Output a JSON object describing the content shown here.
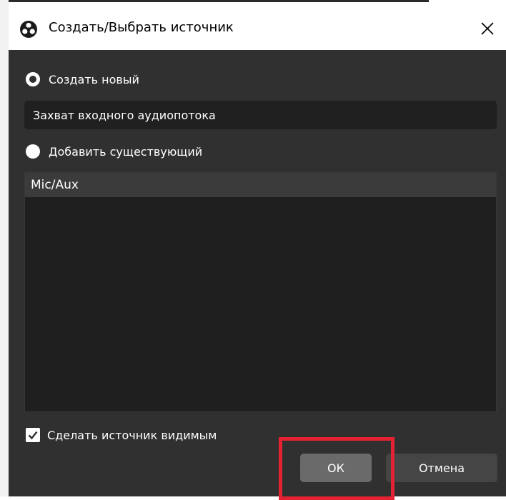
{
  "window": {
    "title": "Создать/Выбрать источник",
    "close_label": "✕"
  },
  "create_new": {
    "label": "Создать новый",
    "selected": true,
    "name_value": "Захват входного аудиопотока"
  },
  "add_existing": {
    "label": "Добавить существующий",
    "selected": false,
    "items": [
      "Mic/Aux"
    ]
  },
  "visible_option": {
    "label": "Сделать источник видимым",
    "checked": true
  },
  "buttons": {
    "ok_label": "ОК",
    "cancel_label": "Отмена"
  },
  "colors": {
    "dialog_bg": "#303030",
    "highlight": "#e52231"
  },
  "icons": {
    "app": "obs-logo-icon",
    "close": "close-icon",
    "check": "checkmark-icon"
  }
}
